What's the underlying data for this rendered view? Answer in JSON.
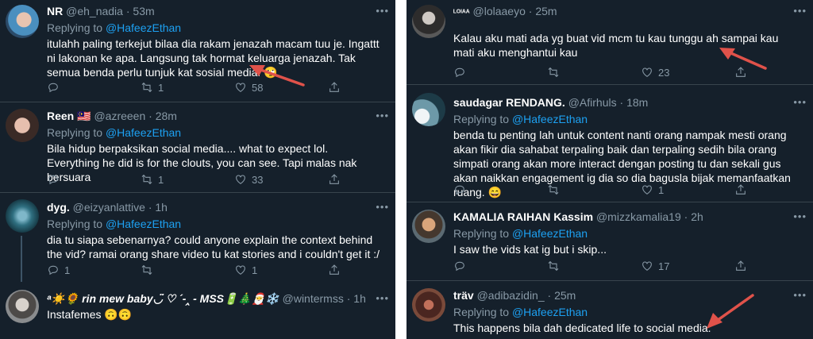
{
  "colors": {
    "bg": "#15202b",
    "mention": "#1da1f2",
    "muted": "#8899a6",
    "arrow": "#e0524a"
  },
  "left": [
    {
      "name": "NR",
      "handle": "@eh_nadia",
      "time": "53m",
      "replying": "Replying to",
      "mention": "@HafeezEthan",
      "text": "itulahh paling terkejut bilaa dia rakam jenazah macam tuu je. Ingattt ni lakonan ke apa. Langsung tak hormat keluarga jenazah. Tak semua benda perlu tunjuk kat sosial media. 🙄",
      "replies": "",
      "retweets": "1",
      "likes": "58"
    },
    {
      "name": "Reen 🇲🇾",
      "handle": "@azreeen",
      "time": "28m",
      "replying": "Replying to",
      "mention": "@HafeezEthan",
      "text": "Bila hidup berpaksikan social media.... what to expect lol. Everything he did is for the clouts, you can see. Tapi malas nak bersuara",
      "replies": "",
      "retweets": "1",
      "likes": "33"
    },
    {
      "name": "dyg.",
      "handle": "@eizyanlattive",
      "time": "1h",
      "replying": "Replying to",
      "mention": "@HafeezEthan",
      "text": "dia tu siapa sebenarnya? could anyone explain the context behind the vid? ramai orang share video tu kat stories and i couldn't get it :/",
      "replies": "1",
      "retweets": "",
      "likes": "1"
    },
    {
      "name": "ᵃ☀️🌻 rin mew baby◡̈ ♡ ´-‸ - MSS🔋🎄🎅❄️",
      "handle": "@wintermss",
      "time": "1h",
      "text": "Instafemes 🙃🙃"
    }
  ],
  "right": [
    {
      "name": "ᴸᴼᴵᴬᴬ",
      "handle": "@lolaaeyo",
      "time": "25m",
      "replying": "",
      "mention": "",
      "text": "Kalau aku mati ada yg buat vid mcm tu kau tunggu ah sampai kau mati aku menghantui kau",
      "replies": "",
      "retweets": "",
      "likes": "23"
    },
    {
      "name": "saudagar RENDANG.",
      "handle": "@Afirhuls",
      "time": "18m",
      "replying": "Replying to",
      "mention": "@HafeezEthan",
      "text": "benda tu penting lah untuk content nanti orang nampak mesti orang akan fikir dia sahabat terpaling baik dan terpaling sedih bila orang simpati orang akan more interact dengan posting tu dan sekali gus akan naikkan engagement ig dia so dia bagusla bijak memanfaatkan ruang. 😄",
      "replies": "",
      "retweets": "",
      "likes": "1"
    },
    {
      "name": "KAMALIA RAIHAN Kassim",
      "handle": "@mizzkamalia19",
      "time": "2h",
      "replying": "Replying to",
      "mention": "@HafeezEthan",
      "text": "I saw the vids kat ig but i skip...",
      "replies": "",
      "retweets": "",
      "likes": "17"
    },
    {
      "name": "träv",
      "handle": "@adibazidin_",
      "time": "25m",
      "replying": "Replying to",
      "mention": "@HafeezEthan",
      "text": "This happens bila dah dedicated life to social media."
    }
  ],
  "icons": {
    "reply": "reply-icon",
    "retweet": "retweet-icon",
    "like": "heart-icon",
    "share": "share-icon",
    "more": "more-icon"
  }
}
